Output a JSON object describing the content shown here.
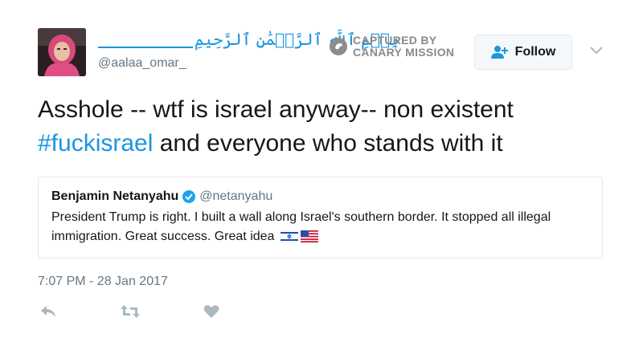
{
  "author": {
    "display_name": "بِسۡمِ ٱللَّهِ ٱلرَّحۡمَٰنِ ٱلرَّحِيمِ",
    "handle": "@aalaa_omar_"
  },
  "watermark": {
    "line1": "CAPTURED BY",
    "line2": "CANARY MISSION"
  },
  "follow_button": {
    "label": "Follow"
  },
  "tweet": {
    "text_before": "Asshole -- wtf is israel anyway-- non existent ",
    "hashtag": "#fuckisrael",
    "text_after": " and everyone who stands with it",
    "timestamp": "7:07 PM - 28 Jan 2017"
  },
  "quoted_tweet": {
    "name": "Benjamin Netanyahu",
    "handle": "@netanyahu",
    "text": "President Trump is right. I built a wall along Israel's southern border. It stopped all illegal immigration. Great success. Great idea"
  },
  "icons": {
    "reply": "reply-icon",
    "retweet": "retweet-icon",
    "like": "heart-icon",
    "more": "chevron-down-icon",
    "follow": "add-user-icon",
    "verified": "verified-badge-icon"
  },
  "colors": {
    "link": "#1b95e0",
    "secondary_text": "#657786",
    "border": "#e1e8ed",
    "icon_gray": "#aab8c2"
  }
}
